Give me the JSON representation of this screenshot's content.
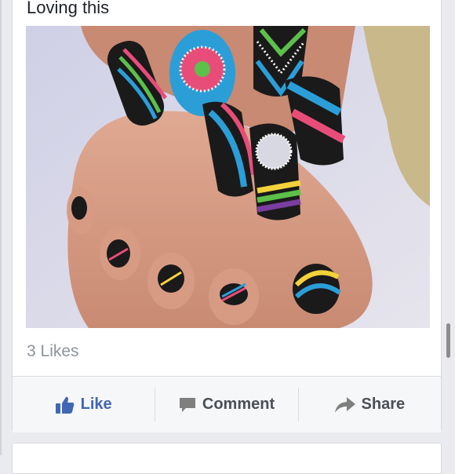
{
  "post": {
    "text": "Loving this",
    "photo_icon": "nail-art-photo",
    "likes_text": "3 Likes"
  },
  "actions": {
    "like_label": "Like",
    "comment_label": "Comment",
    "share_label": "Share"
  },
  "colors": {
    "like_blue": "#4267b2",
    "action_gray": "#4b4f56",
    "likes_gray": "#8d949e",
    "background": "#e9ebee"
  }
}
